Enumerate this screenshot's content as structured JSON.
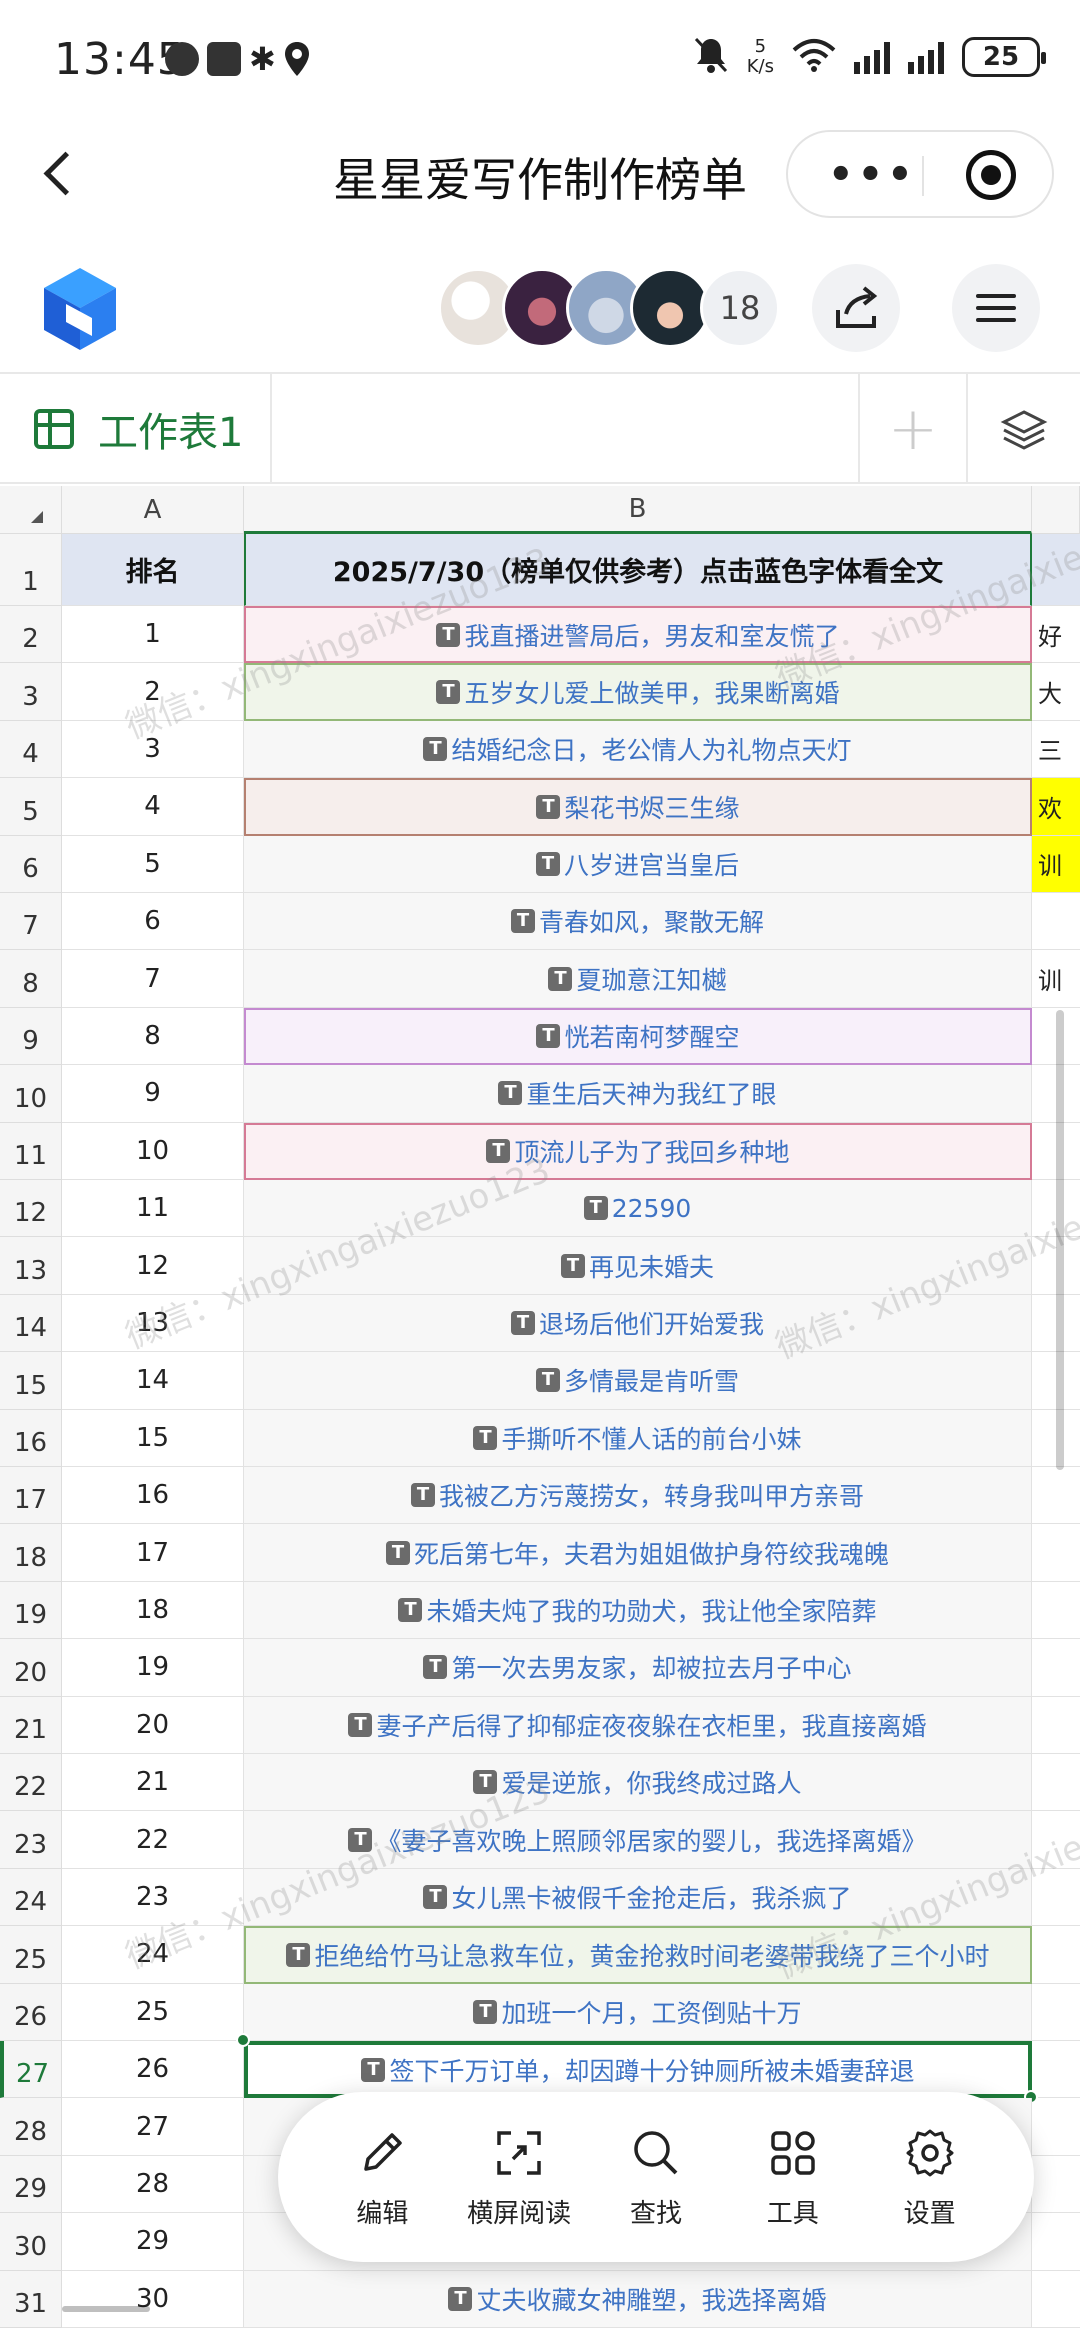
{
  "status_bar": {
    "time": "13:45",
    "net_speed_value": "5",
    "net_speed_unit": "K/s",
    "battery": "25"
  },
  "title_bar": {
    "title": "星星爱写作制作榜单"
  },
  "collaborators": {
    "count": "18"
  },
  "sheet_tab": {
    "label": "工作表1"
  },
  "columns": {
    "A": "A",
    "B": "B"
  },
  "header_row": {
    "num": "1",
    "a": "排名",
    "b": "2025/7/30（榜单仅供参考）点击蓝色字体看全文"
  },
  "rows": [
    {
      "num": "2",
      "a": "1",
      "b": "我直播进警局后，男友和室友慌了",
      "c": "好",
      "style": "hl-pink"
    },
    {
      "num": "3",
      "a": "2",
      "b": "五岁女儿爱上做美甲，我果断离婚",
      "c": "大",
      "style": "hl-green"
    },
    {
      "num": "4",
      "a": "3",
      "b": "结婚纪念日，老公情人为礼物点天灯",
      "c": "三",
      "style": ""
    },
    {
      "num": "5",
      "a": "4",
      "b": "梨花书烬三生缘",
      "c": "欢",
      "style": "hl-brown yellowC"
    },
    {
      "num": "6",
      "a": "5",
      "b": "八岁进宫当皇后",
      "c": "训",
      "style": "yellowC"
    },
    {
      "num": "7",
      "a": "6",
      "b": "青春如风，聚散无解",
      "c": "",
      "style": ""
    },
    {
      "num": "8",
      "a": "7",
      "b": "夏珈意江知樾",
      "c": "训",
      "style": ""
    },
    {
      "num": "9",
      "a": "8",
      "b": "恍若南柯梦醒空",
      "c": "",
      "style": "hl-purple"
    },
    {
      "num": "10",
      "a": "9",
      "b": "重生后天神为我红了眼",
      "c": "",
      "style": ""
    },
    {
      "num": "11",
      "a": "10",
      "b": "顶流儿子为了我回乡种地",
      "c": "",
      "style": "hl-pink"
    },
    {
      "num": "12",
      "a": "11",
      "b": "22590",
      "c": "",
      "style": ""
    },
    {
      "num": "13",
      "a": "12",
      "b": "再见未婚夫",
      "c": "",
      "style": ""
    },
    {
      "num": "14",
      "a": "13",
      "b": "退场后他们开始爱我",
      "c": "",
      "style": ""
    },
    {
      "num": "15",
      "a": "14",
      "b": "多情最是肯听雪",
      "c": "",
      "style": ""
    },
    {
      "num": "16",
      "a": "15",
      "b": "手撕听不懂人话的前台小妹",
      "c": "",
      "style": ""
    },
    {
      "num": "17",
      "a": "16",
      "b": "我被乙方污蔑捞女，转身我叫甲方亲哥",
      "c": "",
      "style": ""
    },
    {
      "num": "18",
      "a": "17",
      "b": "死后第七年，夫君为姐姐做护身符绞我魂魄",
      "c": "",
      "style": ""
    },
    {
      "num": "19",
      "a": "18",
      "b": "未婚夫炖了我的功勋犬，我让他全家陪葬",
      "c": "",
      "style": ""
    },
    {
      "num": "20",
      "a": "19",
      "b": "第一次去男友家，却被拉去月子中心",
      "c": "",
      "style": ""
    },
    {
      "num": "21",
      "a": "20",
      "b": "妻子产后得了抑郁症夜夜躲在衣柜里，我直接离婚",
      "c": "",
      "style": ""
    },
    {
      "num": "22",
      "a": "21",
      "b": "爱是逆旅，你我终成过路人",
      "c": "",
      "style": ""
    },
    {
      "num": "23",
      "a": "22",
      "b": "《妻子喜欢晚上照顾邻居家的婴儿，我选择离婚》",
      "c": "",
      "style": ""
    },
    {
      "num": "24",
      "a": "23",
      "b": "女儿黑卡被假千金抢走后，我杀疯了",
      "c": "",
      "style": ""
    },
    {
      "num": "25",
      "a": "24",
      "b": "拒绝给竹马让急救车位，黄金抢救时间老婆带我绕了三个小时",
      "c": "",
      "style": "hl-green"
    },
    {
      "num": "26",
      "a": "25",
      "b": "加班一个月，工资倒贴十万",
      "c": "",
      "style": ""
    },
    {
      "num": "27",
      "a": "26",
      "b": "签下千万订单，却因蹲十分钟厕所被未婚妻辞退",
      "c": "",
      "style": "selected"
    },
    {
      "num": "28",
      "a": "27",
      "b": "",
      "c": "",
      "style": ""
    },
    {
      "num": "29",
      "a": "28",
      "b": "",
      "c": "",
      "style": ""
    },
    {
      "num": "30",
      "a": "29",
      "b": "",
      "c": "",
      "style": ""
    },
    {
      "num": "31",
      "a": "30",
      "b": "丈夫收藏女神雕塑，我选择离婚",
      "c": "",
      "style": ""
    }
  ],
  "watermark_text": "微信：xingxingaixiezuo123",
  "floating_toolbar": [
    {
      "label": "编辑",
      "icon": "pencil-icon"
    },
    {
      "label": "横屏阅读",
      "icon": "expand-icon"
    },
    {
      "label": "查找",
      "icon": "search-icon"
    },
    {
      "label": "工具",
      "icon": "apps-icon"
    },
    {
      "label": "设置",
      "icon": "gear-icon"
    }
  ],
  "colors": {
    "accent_green": "#1e7a3a",
    "link_blue": "#3e73c4",
    "highlight_yellow": "#ffff00"
  }
}
